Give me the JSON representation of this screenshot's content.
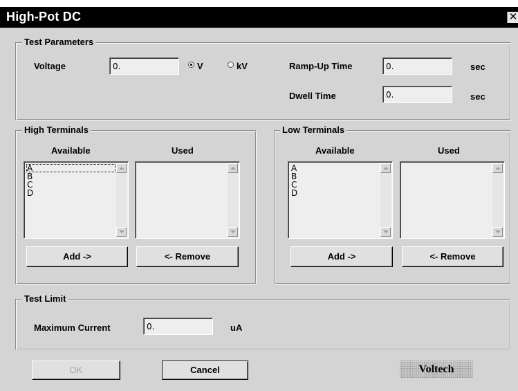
{
  "window": {
    "title": "High-Pot DC",
    "close_glyph": "✕"
  },
  "test_parameters": {
    "legend": "Test Parameters",
    "voltage_label": "Voltage",
    "voltage_value": "0.",
    "unit_v": "V",
    "unit_kv": "kV",
    "selected_unit": "V",
    "ramp_label": "Ramp-Up Time",
    "ramp_value": "0.",
    "ramp_unit": "sec",
    "dwell_label": "Dwell Time",
    "dwell_value": "0.",
    "dwell_unit": "sec"
  },
  "high_terminals": {
    "legend": "High Terminals",
    "available_label": "Available",
    "used_label": "Used",
    "available": [
      "A",
      "B",
      "C",
      "D"
    ],
    "used": [],
    "add_label": "Add ->",
    "remove_label": "<- Remove"
  },
  "low_terminals": {
    "legend": "Low Terminals",
    "available_label": "Available",
    "used_label": "Used",
    "available": [
      "A",
      "B",
      "C",
      "D"
    ],
    "used": [],
    "add_label": "Add ->",
    "remove_label": "<- Remove"
  },
  "test_limit": {
    "legend": "Test Limit",
    "max_current_label": "Maximum Current",
    "max_current_value": "0.",
    "unit": "uA"
  },
  "footer": {
    "ok_label": "OK",
    "cancel_label": "Cancel",
    "logo_text": "Voltech"
  }
}
